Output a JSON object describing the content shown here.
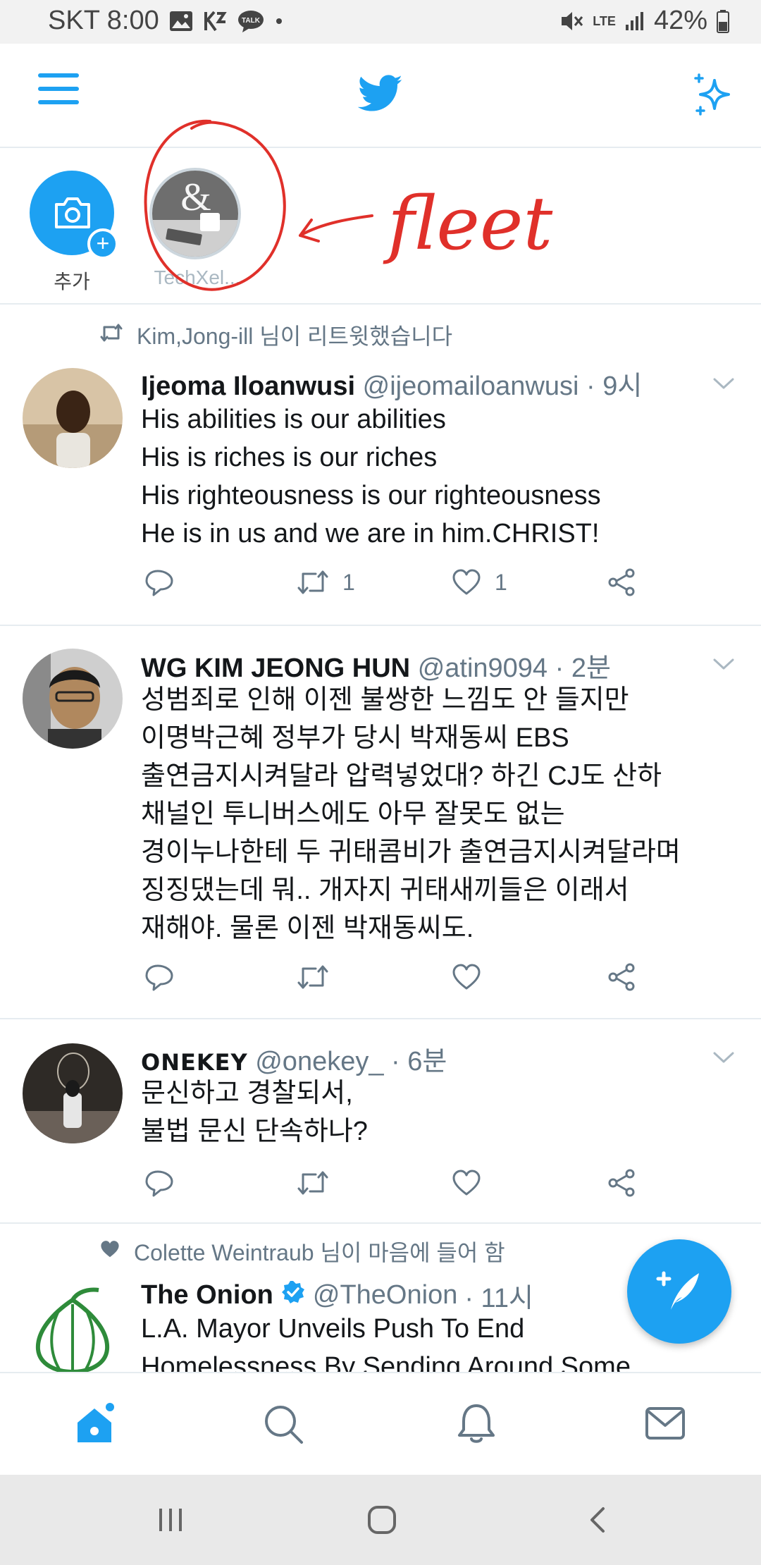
{
  "status_bar": {
    "carrier_time": "SKT 8:00",
    "network": "LTE",
    "battery": "42%"
  },
  "fleets": {
    "add_label": "추가",
    "user_label": "TechXel...",
    "annotation": "fleet"
  },
  "tweets": [
    {
      "context": "Kim,Jong-ill 님이 리트윗했습니다",
      "name": "Ijeoma Iloanwusi",
      "handle": "@ijeomailoanwusi",
      "time": "· 9시",
      "lines": [
        "His abilities is our abilities",
        "His is riches is our riches",
        "His righteousness is our righteousness",
        "He is in us and we are in him.CHRIST!"
      ],
      "retweets": "1",
      "likes": "1"
    },
    {
      "name": "WG KIM JEONG HUN",
      "handle": "@atin9094",
      "time": "· 2분",
      "lines": [
        "성범죄로 인해 이젠 불쌍한 느낌도 안 들지만",
        "이명박근혜 정부가 당시 박재동씨 EBS",
        "출연금지시켜달라 압력넣었대? 하긴 CJ도 산하",
        "채널인 투니버스에도 아무 잘못도 없는",
        "경이누나한테 두 귀태콤비가 출연금지시켜달라며",
        "징징댔는데 뭐.. 개자지 귀태새끼들은 이래서",
        "재해야. 물론 이젠 박재동씨도."
      ]
    },
    {
      "name": "ONEKEY",
      "handle": "@onekey_",
      "time": "· 6분",
      "lines": [
        "문신하고 경찰되서,",
        "불법 문신 단속하나?"
      ]
    },
    {
      "context": "Colette Weintraub 님이 마음에 들어 함",
      "name": "The Onion",
      "handle": "@TheOnion",
      "time": "· 11시",
      "lines": [
        "L.A. Mayor Unveils Push To End",
        "Homelessness By Sending Around Some"
      ]
    }
  ],
  "colors": {
    "accent": "#1da1f2",
    "text": "#14171a",
    "secondary": "#657786",
    "annotation": "#e0302a"
  }
}
